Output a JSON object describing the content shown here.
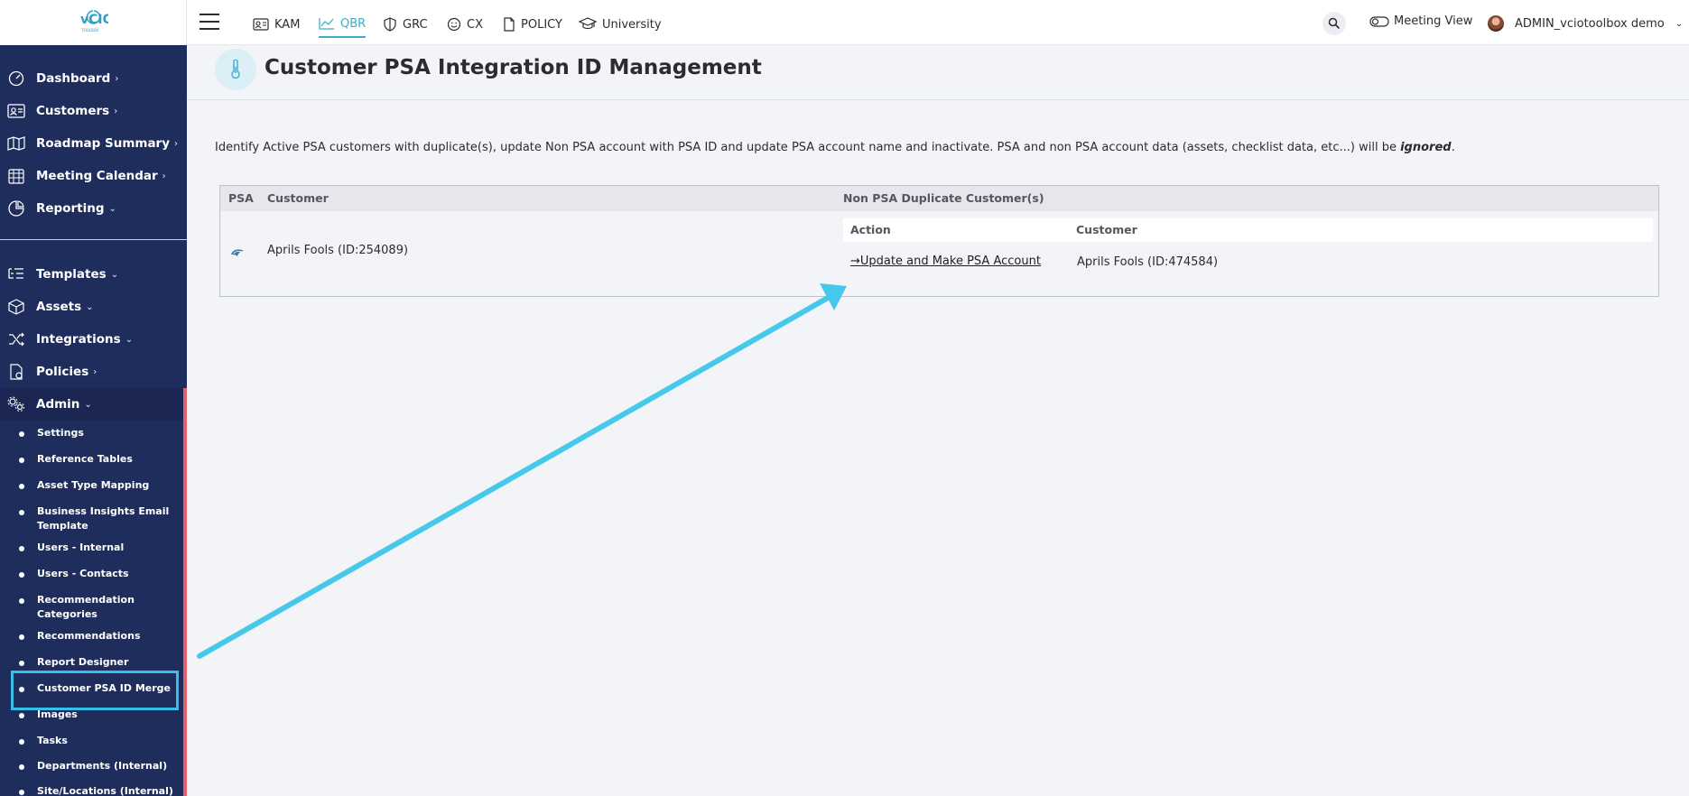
{
  "topbar": {
    "tabs": [
      {
        "label": "KAM"
      },
      {
        "label": "QBR"
      },
      {
        "label": "GRC"
      },
      {
        "label": "CX"
      },
      {
        "label": "POLICY"
      },
      {
        "label": "University"
      }
    ],
    "active_tab": "QBR",
    "meeting_view_label": "Meeting View",
    "user_name": "ADMIN_vciotoolbox demo"
  },
  "sidebar": {
    "nav_items": [
      {
        "label": "Dashboard",
        "icon": "dashboard-icon",
        "chevron": "›"
      },
      {
        "label": "Customers",
        "icon": "customers-icon",
        "chevron": "›"
      },
      {
        "label": "Roadmap Summary",
        "icon": "map-icon",
        "chevron": "›"
      },
      {
        "label": "Meeting Calendar",
        "icon": "calendar-icon",
        "chevron": "›"
      },
      {
        "label": "Reporting",
        "icon": "reporting-icon",
        "chevron": "⌄"
      },
      {
        "label": "Templates",
        "icon": "templates-icon",
        "chevron": "⌄"
      },
      {
        "label": "Assets",
        "icon": "assets-icon",
        "chevron": "⌄"
      },
      {
        "label": "Integrations",
        "icon": "integrations-icon",
        "chevron": "⌄"
      },
      {
        "label": "Policies",
        "icon": "policies-icon",
        "chevron": "›"
      },
      {
        "label": "Admin",
        "icon": "admin-gear-icon",
        "chevron": "⌄"
      }
    ],
    "admin_items": [
      {
        "label": "Settings"
      },
      {
        "label": "Reference Tables"
      },
      {
        "label": "Asset Type Mapping"
      },
      {
        "label": "Business Insights Email Template"
      },
      {
        "label": "Users - Internal"
      },
      {
        "label": "Users - Contacts"
      },
      {
        "label": "Recommendation Categories"
      },
      {
        "label": "Recommendations"
      },
      {
        "label": "Report Designer"
      },
      {
        "label": "Customer PSA ID Merge"
      },
      {
        "label": "Images"
      },
      {
        "label": "Tasks"
      },
      {
        "label": "Departments (Internal)"
      },
      {
        "label": "Site/Locations (Internal)"
      }
    ],
    "highlighted_item": "Customer PSA ID Merge"
  },
  "page": {
    "title": "Customer PSA Integration ID Management",
    "description_main": "Identify Active PSA customers with duplicate(s), update Non PSA account with PSA ID and update PSA account name and inactivate. PSA and non PSA account data (assets, checklist data, etc...) will be ",
    "description_emphasis": "ignored",
    "description_end": "."
  },
  "table": {
    "headers": {
      "psa": "PSA",
      "customer": "Customer",
      "non_psa": "Non PSA Duplicate Customer(s)"
    },
    "inner_headers": {
      "action": "Action",
      "customer": "Customer"
    },
    "rows": [
      {
        "customer": "Aprils Fools (ID:254089)",
        "duplicates": [
          {
            "action_label": "Update and Make PSA Account",
            "customer": "Aprils Fools (ID:474584)"
          }
        ]
      }
    ]
  },
  "colors": {
    "sidebar_bg": "#1f2d5c",
    "accent": "#3ab0c8",
    "annotation": "#35c0ec",
    "rail": "#e0616b"
  }
}
